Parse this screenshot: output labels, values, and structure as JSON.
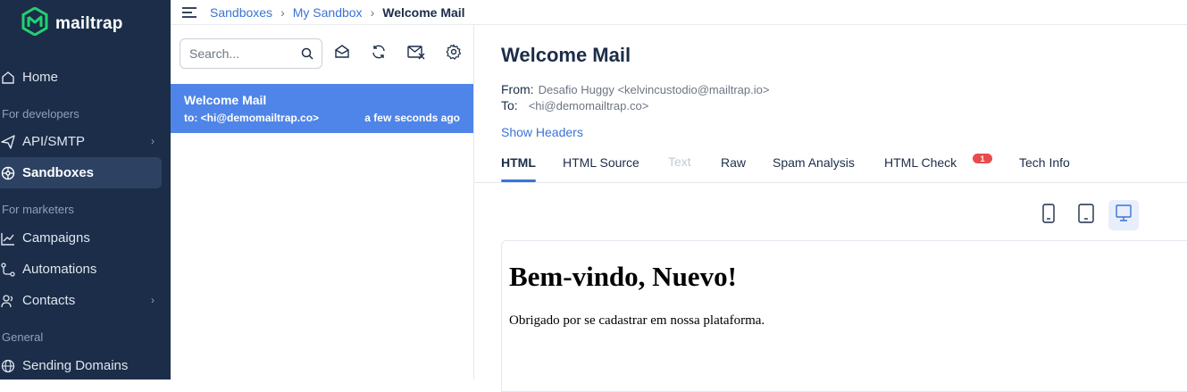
{
  "sidebar": {
    "brand": "mailtrap",
    "items": [
      {
        "label": "Home"
      },
      {
        "section": "For developers"
      },
      {
        "label": "API/SMTP"
      },
      {
        "label": "Sandboxes"
      },
      {
        "section": "For marketers"
      },
      {
        "label": "Campaigns"
      },
      {
        "label": "Automations"
      },
      {
        "label": "Contacts"
      },
      {
        "section": "General"
      },
      {
        "label": "Sending Domains"
      }
    ]
  },
  "breadcrumb": {
    "items": [
      "Sandboxes",
      "My Sandbox"
    ],
    "current": "Welcome Mail",
    "separator": "›"
  },
  "inbox": {
    "search_placeholder": "Search...",
    "messages": [
      {
        "subject": "Welcome Mail",
        "to": "to: <hi@demomailtrap.co>",
        "time": "a few seconds ago"
      }
    ]
  },
  "message": {
    "subject": "Welcome Mail",
    "from_label": "From:",
    "from_value": "Desafio Huggy <kelvincustodio@mailtrap.io>",
    "to_label": "To:",
    "to_value": "<hi@demomailtrap.co>",
    "show_headers": "Show Headers",
    "tabs": [
      "HTML",
      "HTML Source",
      "Text",
      "Raw",
      "Spam Analysis",
      "HTML Check",
      "Tech Info"
    ],
    "html_check_badge": "1",
    "preview": {
      "heading": "Bem-vindo, Nuevo!",
      "body": "Obrigado por se cadastrar em nossa plataforma."
    }
  },
  "colors": {
    "sidebar_bg": "#1b2d48",
    "accent": "#4f85e8",
    "link": "#3a74d4",
    "badge": "#ea4b4b"
  }
}
